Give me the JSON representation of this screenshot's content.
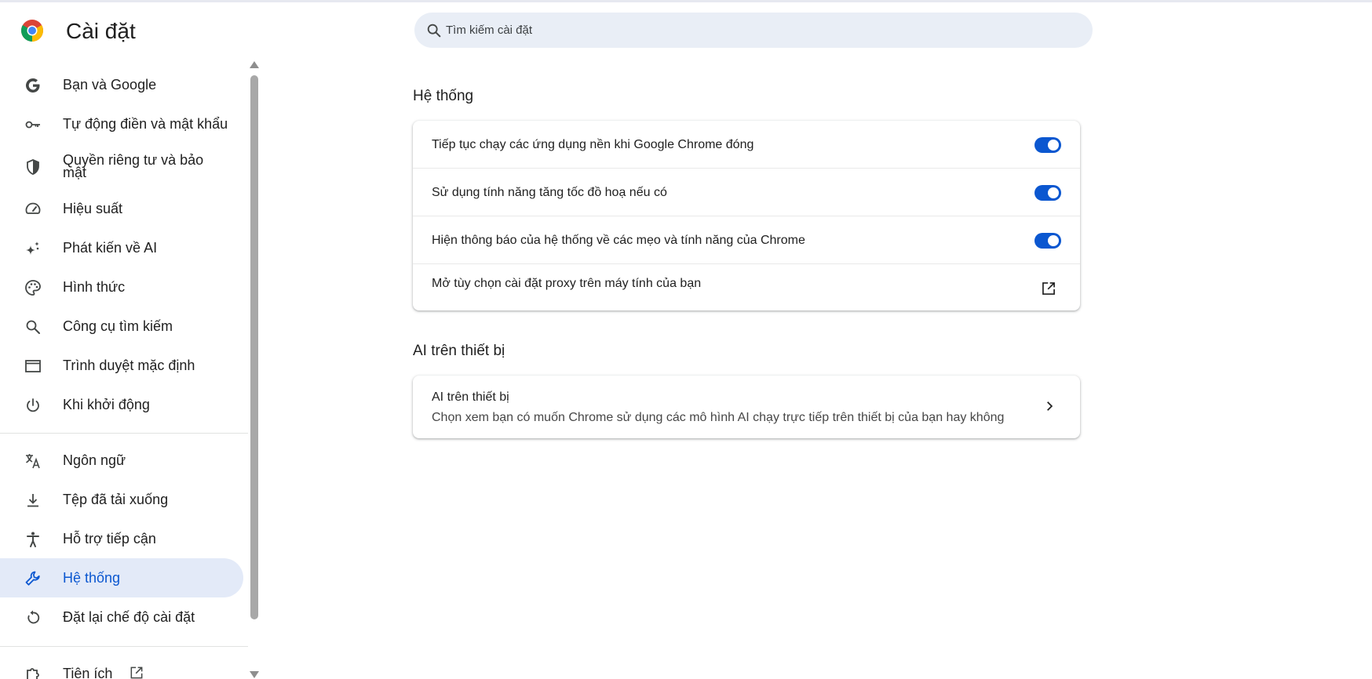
{
  "header": {
    "title": "Cài đặt",
    "search_placeholder": "Tìm kiếm cài đặt"
  },
  "sidebar": {
    "items": [
      {
        "label": "Bạn và Google",
        "icon": "google-g-icon"
      },
      {
        "label": "Tự động điền và mật khẩu",
        "icon": "key-icon"
      },
      {
        "label": "Quyền riêng tư và bảo mật",
        "icon": "shield-icon"
      },
      {
        "label": "Hiệu suất",
        "icon": "speedometer-icon"
      },
      {
        "label": "Phát kiến về AI",
        "icon": "sparkle-icon"
      },
      {
        "label": "Hình thức",
        "icon": "palette-icon"
      },
      {
        "label": "Công cụ tìm kiếm",
        "icon": "search-icon"
      },
      {
        "label": "Trình duyệt mặc định",
        "icon": "browser-window-icon"
      },
      {
        "label": "Khi khởi động",
        "icon": "power-icon"
      },
      {
        "label": "Ngôn ngữ",
        "icon": "translate-icon"
      },
      {
        "label": "Tệp đã tải xuống",
        "icon": "download-icon"
      },
      {
        "label": "Hỗ trợ tiếp cận",
        "icon": "accessibility-icon"
      },
      {
        "label": "Hệ thống",
        "icon": "wrench-icon",
        "active": true
      },
      {
        "label": "Đặt lại chế độ cài đặt",
        "icon": "reset-icon"
      },
      {
        "label": "Tiện ích",
        "icon": "puzzle-icon"
      }
    ]
  },
  "main": {
    "system": {
      "title": "Hệ thống",
      "rows": [
        {
          "label": "Tiếp tục chạy các ứng dụng nền khi Google Chrome đóng",
          "toggle": true
        },
        {
          "label": "Sử dụng tính năng tăng tốc đồ hoạ nếu có",
          "toggle": true
        },
        {
          "label": "Hiện thông báo của hệ thống về các mẹo và tính năng của Chrome",
          "toggle": true
        },
        {
          "label": "Mở tùy chọn cài đặt proxy trên máy tính của bạn",
          "icon": "open-in-new-icon"
        }
      ]
    },
    "ai": {
      "title": "AI trên thiết bị",
      "row_title": "AI trên thiết bị",
      "row_subtitle": "Chọn xem bạn có muốn Chrome sử dụng các mô hình AI chạy trực tiếp trên thiết bị của bạn hay không"
    }
  },
  "colors": {
    "accent": "#0b57d0",
    "active_bg": "#e3eaf8",
    "search_bg": "#e9eef6"
  }
}
